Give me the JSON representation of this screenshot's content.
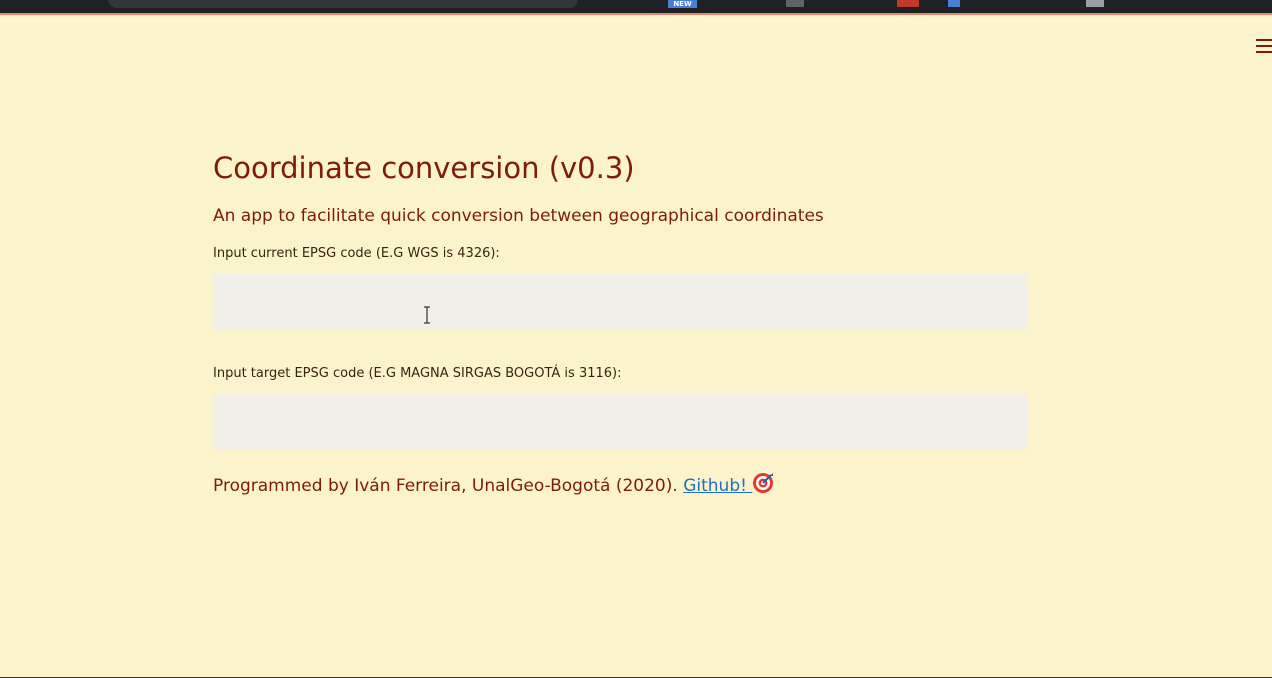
{
  "browser": {
    "new_badge": "NEW"
  },
  "header": {
    "menu_icon": "hamburger-menu-icon"
  },
  "app": {
    "title": "Coordinate conversion (v0.3)",
    "subtitle": "An app to facilitate quick conversion between geographical coordinates",
    "current_epsg": {
      "label": "Input current EPSG code (E.G WGS is 4326):",
      "value": ""
    },
    "target_epsg": {
      "label": "Input target EPSG code (E.G MAGNA SIRGAS BOGOTÁ is 3116):",
      "value": ""
    },
    "footer": {
      "text": "Programmed by Iván Ferreira, UnalGeo-Bogotá (2020). ",
      "link_label": "Github!",
      "link_icon": "target-icon"
    }
  },
  "colors": {
    "background": "#fbf3cb",
    "primary_text": "#7e1c08",
    "input_background": "#f0efea",
    "link": "#1f6fc2"
  }
}
